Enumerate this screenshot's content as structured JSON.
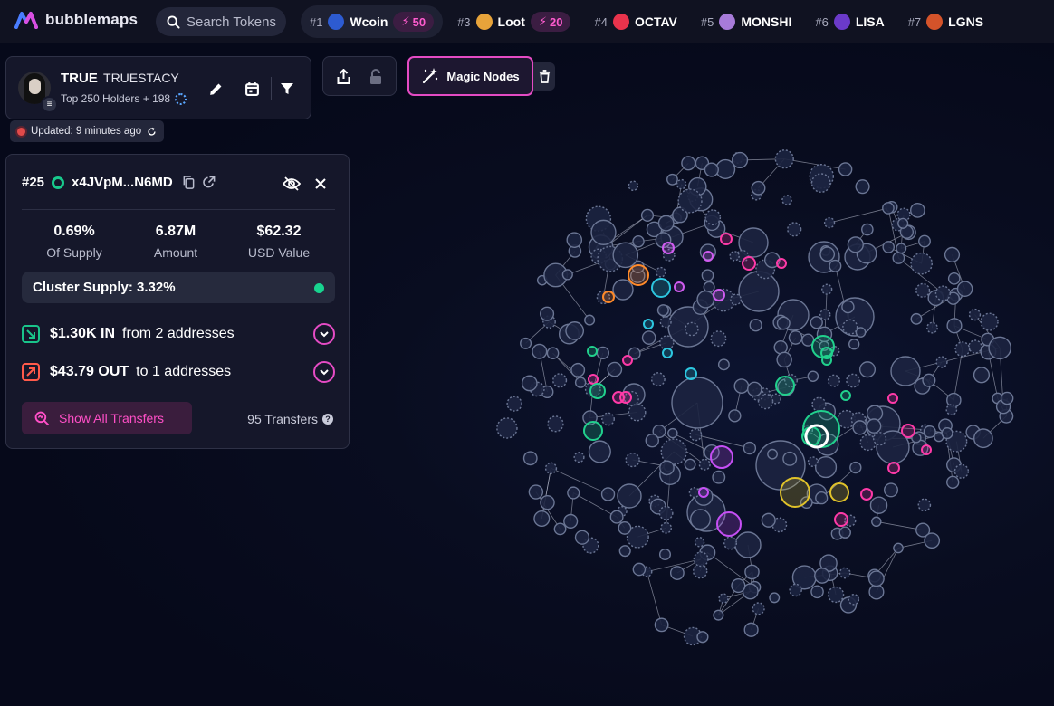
{
  "app": {
    "logo_text": "bubblemaps",
    "logo_colors": [
      "#4a7dff",
      "#d94ee0"
    ]
  },
  "search": {
    "label": "Search Tokens",
    "icon": "search-icon"
  },
  "ticker": [
    {
      "rank": "#1",
      "name": "Wcoin",
      "boost": "50",
      "icon_color": "#2d5bd1",
      "pill": true
    },
    {
      "rank": "#3",
      "name": "Loot",
      "boost": "20",
      "icon_color": "#e7a33a",
      "pill": false
    },
    {
      "rank": "#4",
      "name": "OCTAV",
      "boost": "",
      "icon_color": "#e8334c",
      "pill": false
    },
    {
      "rank": "#5",
      "name": "MONSHI",
      "boost": "",
      "icon_color": "#a77bd9",
      "pill": false
    },
    {
      "rank": "#6",
      "name": "LISA",
      "boost": "",
      "icon_color": "#6b3ac9",
      "pill": false
    },
    {
      "rank": "#7",
      "name": "LGNS",
      "boost": "",
      "icon_color": "#d4532a",
      "pill": false
    }
  ],
  "token": {
    "symbol": "TRUE",
    "name": "TRUESTACY",
    "subtitle": "Top 250 Holders + 198",
    "updated": "Updated: 9 minutes ago"
  },
  "toolbar": {
    "magic_nodes": "Magic Nodes"
  },
  "detail": {
    "rank": "#25",
    "address": "x4JVpM...N6MD",
    "stats": [
      {
        "value": "0.69%",
        "label": "Of Supply"
      },
      {
        "value": "6.87M",
        "label": "Amount"
      },
      {
        "value": "$62.32",
        "label": "USD Value"
      }
    ],
    "cluster_supply": "Cluster Supply: 3.32%",
    "in": {
      "amount": "$1.30K IN",
      "text": "from 2 addresses"
    },
    "out": {
      "amount": "$43.79 OUT",
      "text": "to 1 addresses"
    },
    "show_all": "Show All Transfers",
    "transfers": "95 Transfers"
  },
  "colors": {
    "accent": "#e44bc4",
    "green": "#18d38f",
    "in": "#19c48a",
    "out": "#ff5a4a",
    "bubble": "#2b3450"
  }
}
